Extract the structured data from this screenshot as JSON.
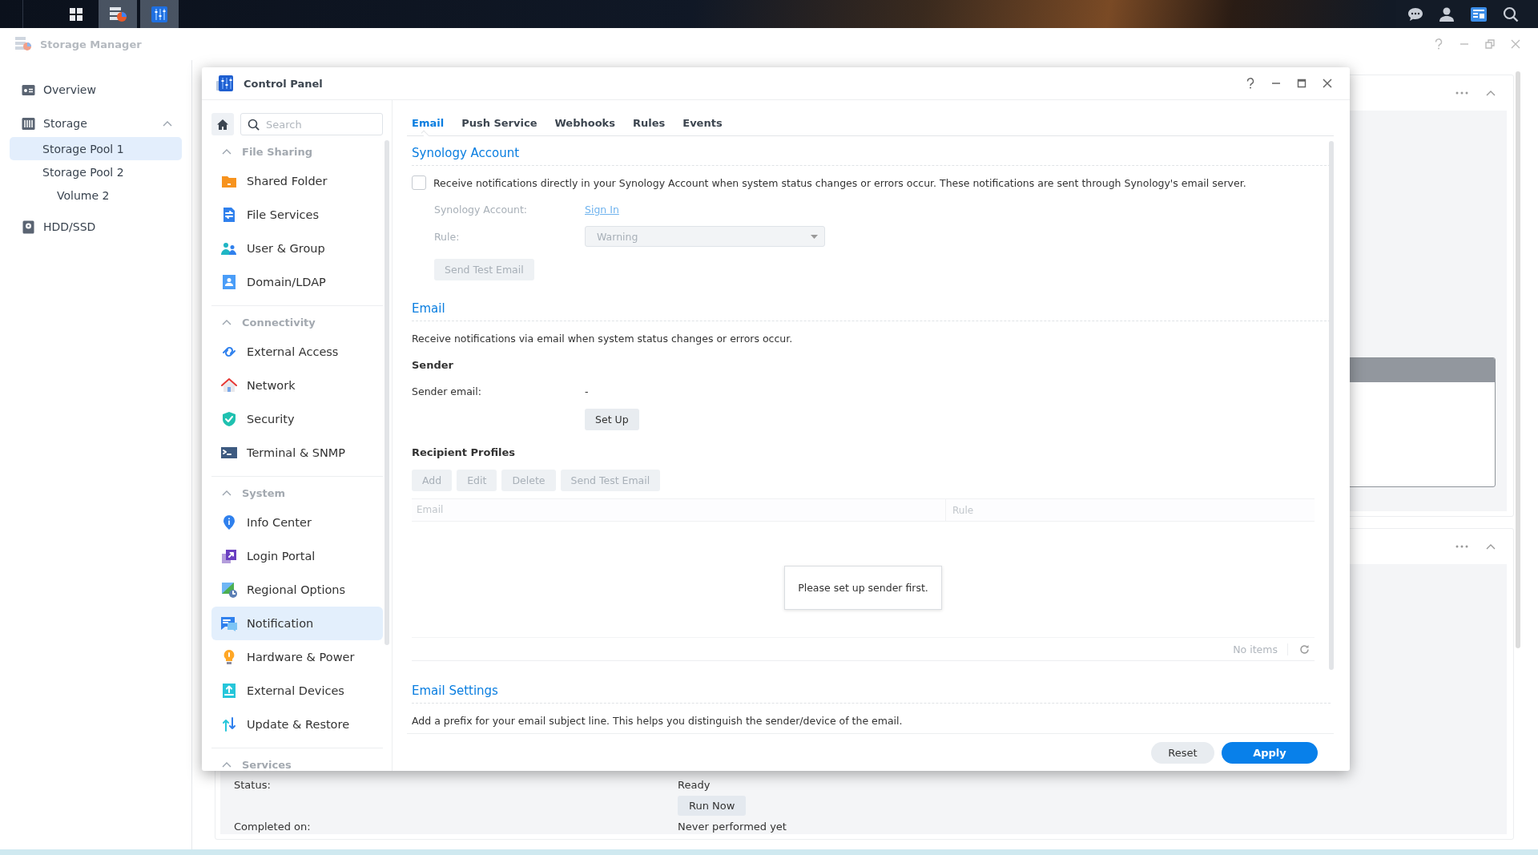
{
  "taskbar": {
    "apps": [
      {
        "selected": false
      },
      {
        "selected": true
      },
      {
        "selected": true
      }
    ]
  },
  "storage_manager": {
    "title": "Storage Manager",
    "nav": [
      {
        "label": "Overview",
        "selected": false
      },
      {
        "label": "Storage",
        "selected": false,
        "expanded": true,
        "children": [
          {
            "label": "Storage Pool 1",
            "selected": true
          },
          {
            "label": "Storage Pool 2",
            "selected": false,
            "children": [
              {
                "label": "Volume 2",
                "selected": false
              }
            ]
          }
        ]
      },
      {
        "label": "HDD/SSD",
        "selected": false
      }
    ],
    "task": {
      "status_label": "Status:",
      "status_value": "Ready",
      "run_button": "Run Now",
      "completed_label": "Completed on:",
      "completed_value": "Never performed yet"
    }
  },
  "control_panel": {
    "title": "Control Panel",
    "search": {
      "placeholder": "Search"
    },
    "groups": [
      {
        "label": "File Sharing",
        "expanded": true,
        "items": [
          {
            "label": "Shared Folder",
            "selected": false
          },
          {
            "label": "File Services",
            "selected": false
          },
          {
            "label": "User & Group",
            "selected": false
          },
          {
            "label": "Domain/LDAP",
            "selected": false
          }
        ]
      },
      {
        "label": "Connectivity",
        "expanded": true,
        "items": [
          {
            "label": "External Access",
            "selected": false
          },
          {
            "label": "Network",
            "selected": false
          },
          {
            "label": "Security",
            "selected": false
          },
          {
            "label": "Terminal & SNMP",
            "selected": false
          }
        ]
      },
      {
        "label": "System",
        "expanded": true,
        "items": [
          {
            "label": "Info Center",
            "selected": false
          },
          {
            "label": "Login Portal",
            "selected": false
          },
          {
            "label": "Regional Options",
            "selected": false
          },
          {
            "label": "Notification",
            "selected": true
          },
          {
            "label": "Hardware & Power",
            "selected": false
          },
          {
            "label": "External Devices",
            "selected": false
          },
          {
            "label": "Update & Restore",
            "selected": false
          }
        ]
      },
      {
        "label": "Services",
        "expanded": true
      }
    ],
    "tabs": [
      {
        "label": "Email",
        "selected": true
      },
      {
        "label": "Push Service",
        "selected": false
      },
      {
        "label": "Webhooks",
        "selected": false
      },
      {
        "label": "Rules",
        "selected": false
      },
      {
        "label": "Events",
        "selected": false
      }
    ],
    "synology_account": {
      "heading": "Synology Account",
      "checkbox": {
        "label": "Receive notifications directly in your Synology Account when system status changes or errors occur. These notifications are sent through Synology's email server.",
        "checked": false
      },
      "disabled": true,
      "account_label": "Synology Account:",
      "sign_in": "Sign In",
      "rule_label": "Rule:",
      "rule_value": "Warning",
      "test_button": "Send Test Email"
    },
    "email": {
      "heading": "Email",
      "description": "Receive notifications via email when system status changes or errors occur.",
      "sender_heading": "Sender",
      "sender_label": "Sender email:",
      "sender_value": "-",
      "setup_button": "Set Up",
      "recipients_heading": "Recipient Profiles",
      "buttons": [
        {
          "label": "Add",
          "disabled": true
        },
        {
          "label": "Edit",
          "disabled": true
        },
        {
          "label": "Delete",
          "disabled": true
        },
        {
          "label": "Send Test Email",
          "disabled": true
        }
      ],
      "columns": [
        "Email",
        "Rule"
      ],
      "empty_message": "Please set up sender first.",
      "count": "No items"
    },
    "email_settings": {
      "heading": "Email Settings",
      "description": "Add a prefix for your email subject line. This helps you distinguish the sender/device of the email."
    },
    "footer": {
      "reset": "Reset",
      "apply": "Apply"
    }
  }
}
